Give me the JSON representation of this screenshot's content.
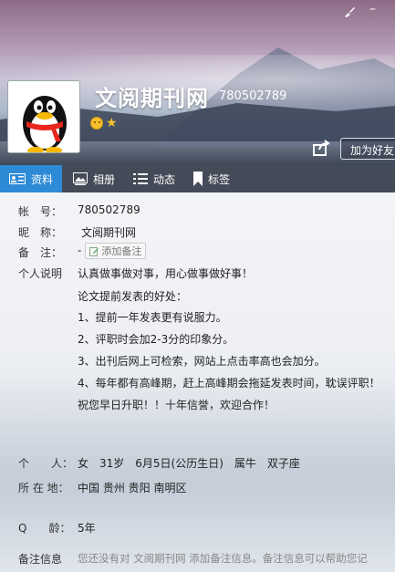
{
  "window_controls": {
    "skin_icon": "brush-icon",
    "minimize_label": "–"
  },
  "profile": {
    "name": "文阅期刊网",
    "qq_number": "780502789",
    "add_friend_label": "加为好友"
  },
  "tabs": [
    {
      "label": "资料",
      "icon": "profile-card-icon",
      "active": true
    },
    {
      "label": "相册",
      "icon": "album-icon",
      "active": false
    },
    {
      "label": "动态",
      "icon": "feed-list-icon",
      "active": false
    },
    {
      "label": "标签",
      "icon": "bookmark-icon",
      "active": false
    }
  ],
  "details": {
    "account_label": "帐　号：",
    "account_value": "780502789",
    "nickname_label": "昵　称：",
    "nickname_value": "文阅期刊网",
    "memo_label": "备　注：",
    "memo_value": "-",
    "add_memo_label": "添加备注",
    "bio_label": "个人说明",
    "bio_lines": [
      "认真做事做对事，用心做事做好事！",
      "论文提前发表的好处：",
      "1、提前一年发表更有说服力。",
      "2、评职时会加2-3分的印象分。",
      "3、出刊后网上可检索，网站上点击率高也会加分。",
      "4、每年都有高峰期，赶上高峰期会拖延发表时间，耽误评职！",
      "祝您早日升职！！十年信誉，欢迎合作！"
    ],
    "person_label": "个　　人：",
    "person_value": "女　31岁　6月5日(公历生日)　属牛　双子座",
    "location_label": "所 在 地：",
    "location_value": "中国 贵州 贵阳 南明区",
    "qage_label": "Q　　龄：",
    "qage_value": "5年",
    "memo_info_label": "备注信息",
    "memo_info_value": "您还没有对 文阅期刊网 添加备注信息。备注信息可以帮助您记"
  }
}
